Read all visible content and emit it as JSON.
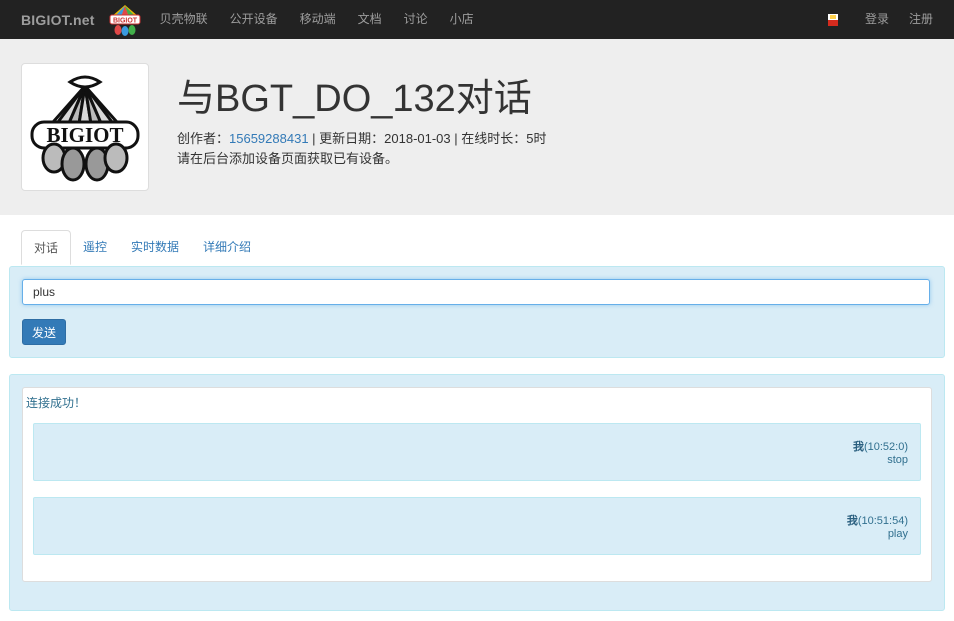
{
  "navbar": {
    "brand": "BIGIOT.net",
    "items": [
      "贝壳物联",
      "公开设备",
      "移动端",
      "文档",
      "讨论",
      "小店"
    ],
    "login": "登录",
    "register": "注册"
  },
  "header": {
    "title": "与BGT_DO_132对话",
    "creator_label": "创作者：",
    "creator": "15659288431",
    "meta_rest": " | 更新日期：2018-01-03 | 在线时长：5时",
    "note": "请在后台添加设备页面获取已有设备。",
    "logo_text": "BIGIOT"
  },
  "tabs": [
    "对话",
    "遥控",
    "实时数据",
    "详细介绍"
  ],
  "input": {
    "value": "plus",
    "send_label": "发送"
  },
  "log": {
    "status": "连接成功！",
    "messages": [
      {
        "who": "我",
        "time": "(10:52:0)",
        "text": "stop"
      },
      {
        "who": "我",
        "time": "(10:51:54)",
        "text": "play"
      }
    ]
  },
  "colors": {
    "navbar": "#222222",
    "link": "#337ab7",
    "info_bg": "#d9edf7",
    "info_border": "#bce8f1",
    "info_text": "#31708f"
  }
}
